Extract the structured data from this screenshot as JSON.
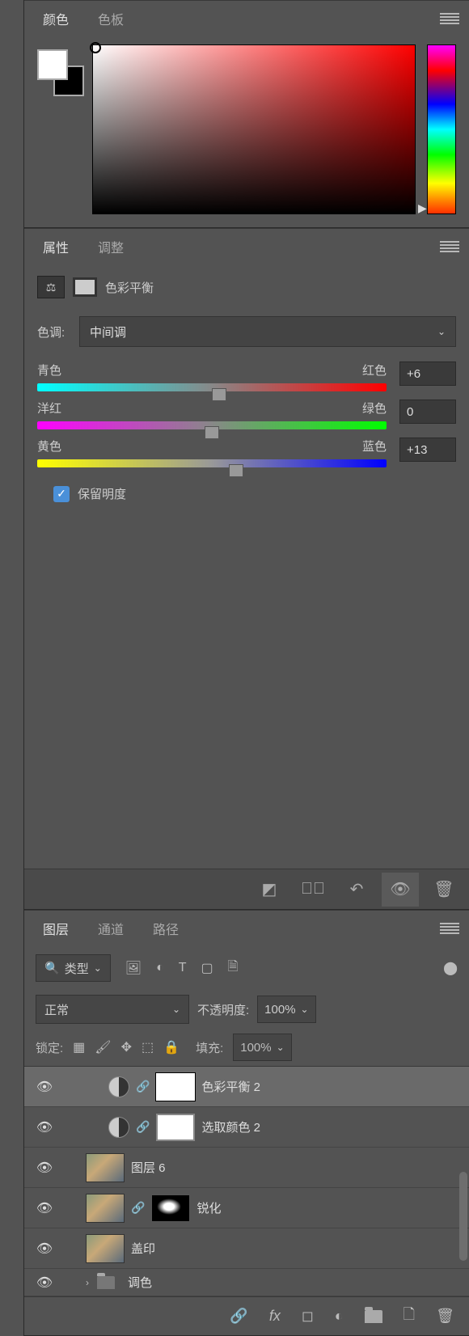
{
  "colorPanel": {
    "tabs": {
      "color": "颜色",
      "swatches": "色板"
    }
  },
  "propPanel": {
    "tabs": {
      "properties": "属性",
      "adjust": "调整"
    },
    "title": "色彩平衡",
    "toneLabel": "色调:",
    "toneValue": "中间调",
    "sliders": [
      {
        "left": "青色",
        "right": "红色",
        "value": "+6",
        "pos": 52
      },
      {
        "left": "洋红",
        "right": "绿色",
        "value": "0",
        "pos": 50
      },
      {
        "left": "黄色",
        "right": "蓝色",
        "value": "+13",
        "pos": 57
      }
    ],
    "preserve": "保留明度"
  },
  "layersPanel": {
    "tabs": {
      "layers": "图层",
      "channels": "通道",
      "paths": "路径"
    },
    "filterLabel": "类型",
    "blendMode": "正常",
    "opacityLabel": "不透明度:",
    "opacityValue": "100%",
    "lockLabel": "锁定:",
    "fillLabel": "填充:",
    "fillValue": "100%",
    "layers": [
      {
        "name": "色彩平衡 2"
      },
      {
        "name": "选取颜色 2"
      },
      {
        "name": "图层 6"
      },
      {
        "name": "锐化"
      },
      {
        "name": "盖印"
      },
      {
        "name": "调色"
      }
    ]
  }
}
